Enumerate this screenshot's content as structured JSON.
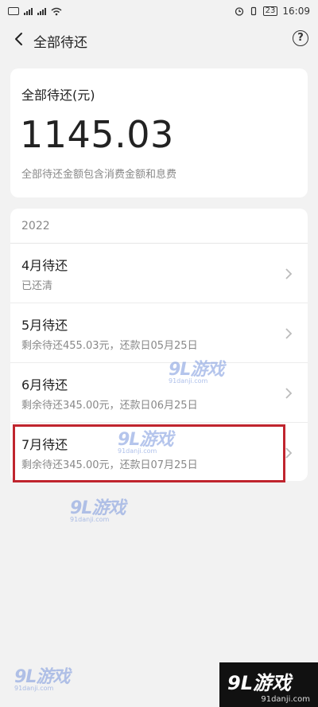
{
  "status_bar": {
    "time": "16:09",
    "battery": "23"
  },
  "nav": {
    "title": "全部待还"
  },
  "summary": {
    "label": "全部待还(元)",
    "amount": "1145.03",
    "note": "全部待还金额包含消费金额和息费"
  },
  "list": {
    "year": "2022",
    "items": [
      {
        "title": "4月待还",
        "subtitle": "已还清"
      },
      {
        "title": "5月待还",
        "subtitle": "剩余待还455.03元，还款日05月25日"
      },
      {
        "title": "6月待还",
        "subtitle": "剩余待还345.00元，还款日06月25日"
      },
      {
        "title": "7月待还",
        "subtitle": "剩余待还345.00元，还款日07月25日"
      }
    ]
  },
  "watermark": {
    "main": "9L游戏",
    "sub": "91danji.com"
  },
  "colors": {
    "highlight": "#c0252e",
    "background": "#f2f2f2"
  },
  "icons": [
    "back-arrow-icon",
    "help-icon",
    "chevron-right-icon",
    "wifi-icon",
    "signal-icon",
    "battery-icon",
    "alarm-icon"
  ]
}
